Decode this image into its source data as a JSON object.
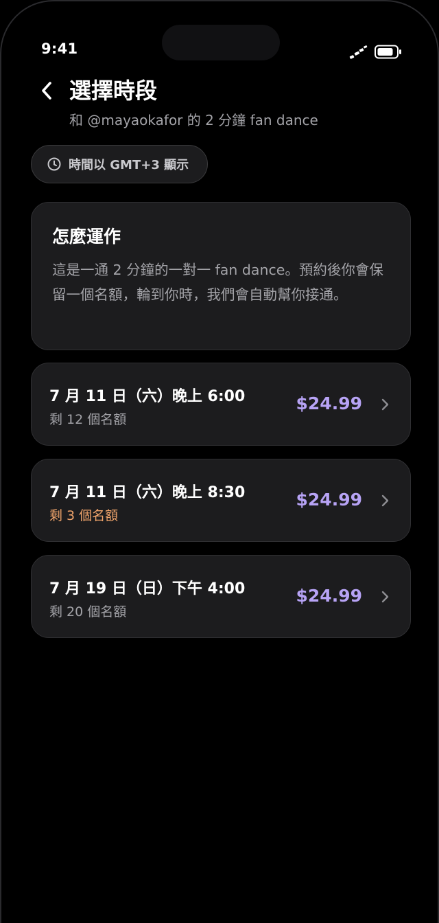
{
  "status_bar": {
    "time": "9:41"
  },
  "header": {
    "title": "選擇時段",
    "subtitle": "和 @mayaokafor 的 2 分鐘 fan dance"
  },
  "timezone_chip": {
    "label": "時間以 GMT+3 顯示"
  },
  "info_card": {
    "title": "怎麼運作",
    "body": "這是一通 2 分鐘的一對一 fan dance。預約後你會保留一個名額，輪到你時，我們會自動幫你接通。"
  },
  "slots": [
    {
      "when": "7 月 11 日（六）晚上 6:00",
      "remaining": "剩 12 個名額",
      "price": "$24.99",
      "low": false
    },
    {
      "when": "7 月 11 日（六）晚上 8:30",
      "remaining": "剩 3 個名額",
      "price": "$24.99",
      "low": true
    },
    {
      "when": "7 月 19 日（日）下午 4:00",
      "remaining": "剩 20 個名額",
      "price": "$24.99",
      "low": false
    }
  ],
  "colors": {
    "background": "#000000",
    "card": "#1c1c1e",
    "price_accent": "#b7a3f5",
    "low_stock": "#f0a46b",
    "secondary_text": "#a3a3a8"
  },
  "icons": {
    "back": "chevron-left-icon",
    "clock": "clock-icon",
    "slot_chevron": "chevron-right-icon",
    "signal": "signal-icon",
    "battery": "battery-icon"
  }
}
